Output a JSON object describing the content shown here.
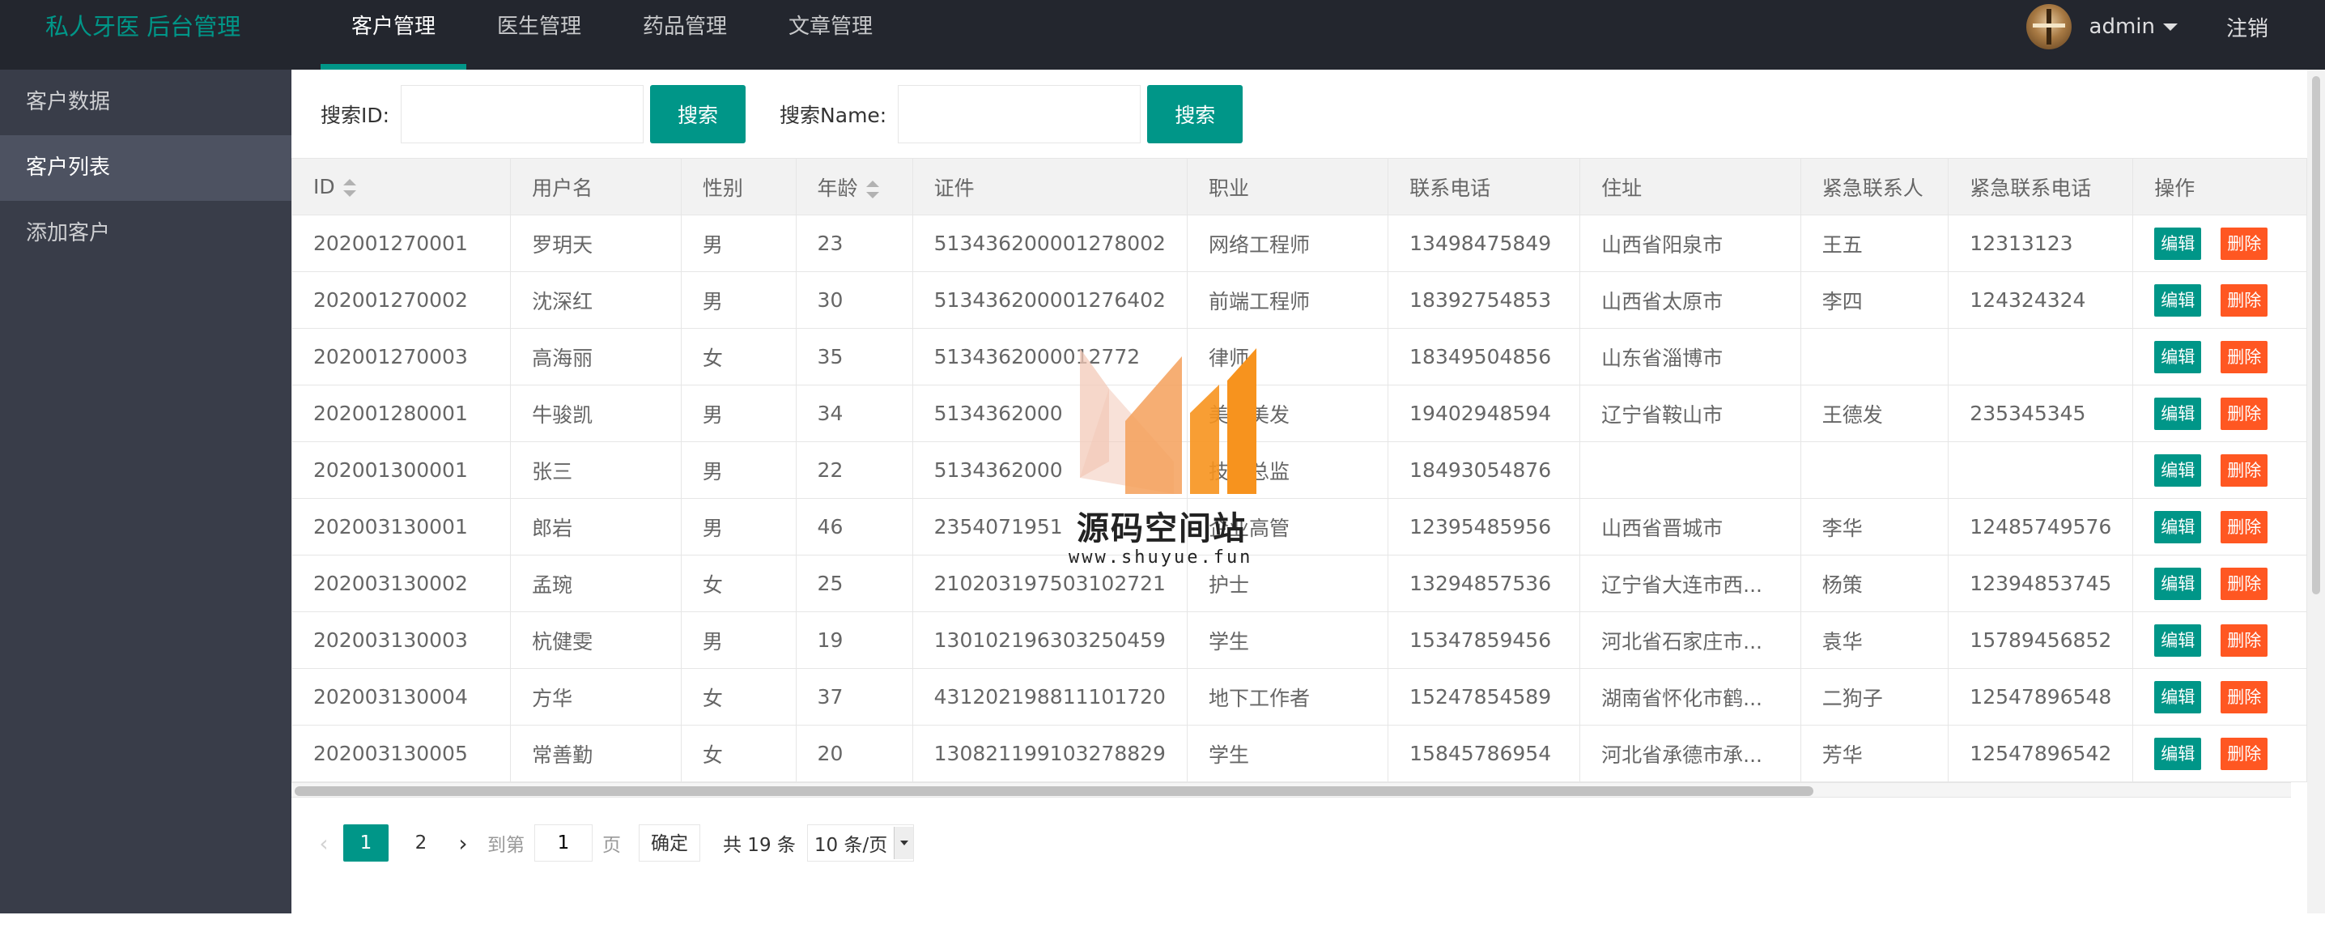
{
  "app": {
    "logo": "私人牙医 后台管理"
  },
  "nav": {
    "items": [
      {
        "label": "客户管理"
      },
      {
        "label": "医生管理"
      },
      {
        "label": "药品管理"
      },
      {
        "label": "文章管理"
      }
    ],
    "active": 0
  },
  "user": {
    "name": "admin",
    "logout": "注销"
  },
  "sidebar": {
    "items": [
      {
        "label": "客户数据"
      },
      {
        "label": "客户列表"
      },
      {
        "label": "添加客户"
      }
    ],
    "active": 1
  },
  "search": {
    "id_label": "搜索ID:",
    "id_value": "",
    "id_button": "搜索",
    "name_label": "搜索Name:",
    "name_value": "",
    "name_button": "搜索"
  },
  "table": {
    "columns": [
      "ID",
      "用户名",
      "性别",
      "年龄",
      "证件",
      "职业",
      "联系电话",
      "住址",
      "紧急联系人",
      "紧急联系电话",
      "操作"
    ],
    "rows": [
      [
        "202001270001",
        "罗玥天",
        "男",
        "23",
        "513436200001278002",
        "网络工程师",
        "13498475849",
        "山西省阳泉市",
        "王五",
        "12313123"
      ],
      [
        "202001270002",
        "沈深红",
        "男",
        "30",
        "513436200001276402",
        "前端工程师",
        "18392754853",
        "山西省太原市",
        "李四",
        "124324324"
      ],
      [
        "202001270003",
        "高海丽",
        "女",
        "35",
        "5134362000012772",
        "律师",
        "18349504856",
        "山东省淄博市",
        "",
        ""
      ],
      [
        "202001280001",
        "牛骏凯",
        "男",
        "34",
        "5134362000",
        "美容美发",
        "19402948594",
        "辽宁省鞍山市",
        "王德发",
        "235345345"
      ],
      [
        "202001300001",
        "张三",
        "男",
        "22",
        "5134362000",
        "技术总监",
        "18493054876",
        "",
        "",
        ""
      ],
      [
        "202003130001",
        "郎岩",
        "男",
        "46",
        "2354071951",
        "企业高管",
        "12395485956",
        "山西省晋城市",
        "李华",
        "12485749576"
      ],
      [
        "202003130002",
        "孟琬",
        "女",
        "25",
        "210203197503102721",
        "护士",
        "13294857536",
        "辽宁省大连市西...",
        "杨策",
        "12394853745"
      ],
      [
        "202003130003",
        "杭健雯",
        "男",
        "19",
        "130102196303250459",
        "学生",
        "15347859456",
        "河北省石家庄市...",
        "袁华",
        "15789456852"
      ],
      [
        "202003130004",
        "方华",
        "女",
        "37",
        "431202198811101720",
        "地下工作者",
        "15247854589",
        "湖南省怀化市鹤...",
        "二狗子",
        "12547896548"
      ],
      [
        "202003130005",
        "常善勤",
        "女",
        "20",
        "130821199103278829",
        "学生",
        "15845786954",
        "河北省承德市承...",
        "芳华",
        "12547896542"
      ]
    ],
    "edit_label": "编辑",
    "delete_label": "删除"
  },
  "pager": {
    "pages": [
      "1",
      "2"
    ],
    "current": "1",
    "goto_label": "到第",
    "goto_value": "1",
    "page_unit": "页",
    "confirm": "确定",
    "total": "共 19 条",
    "page_size": "10 条/页"
  },
  "watermark": {
    "title": "源码空间站",
    "url": "www.shuyue.fun"
  },
  "colors": {
    "primary": "#009688",
    "danger": "#ff5722",
    "header": "#23262e",
    "sidebar": "#393d49"
  }
}
